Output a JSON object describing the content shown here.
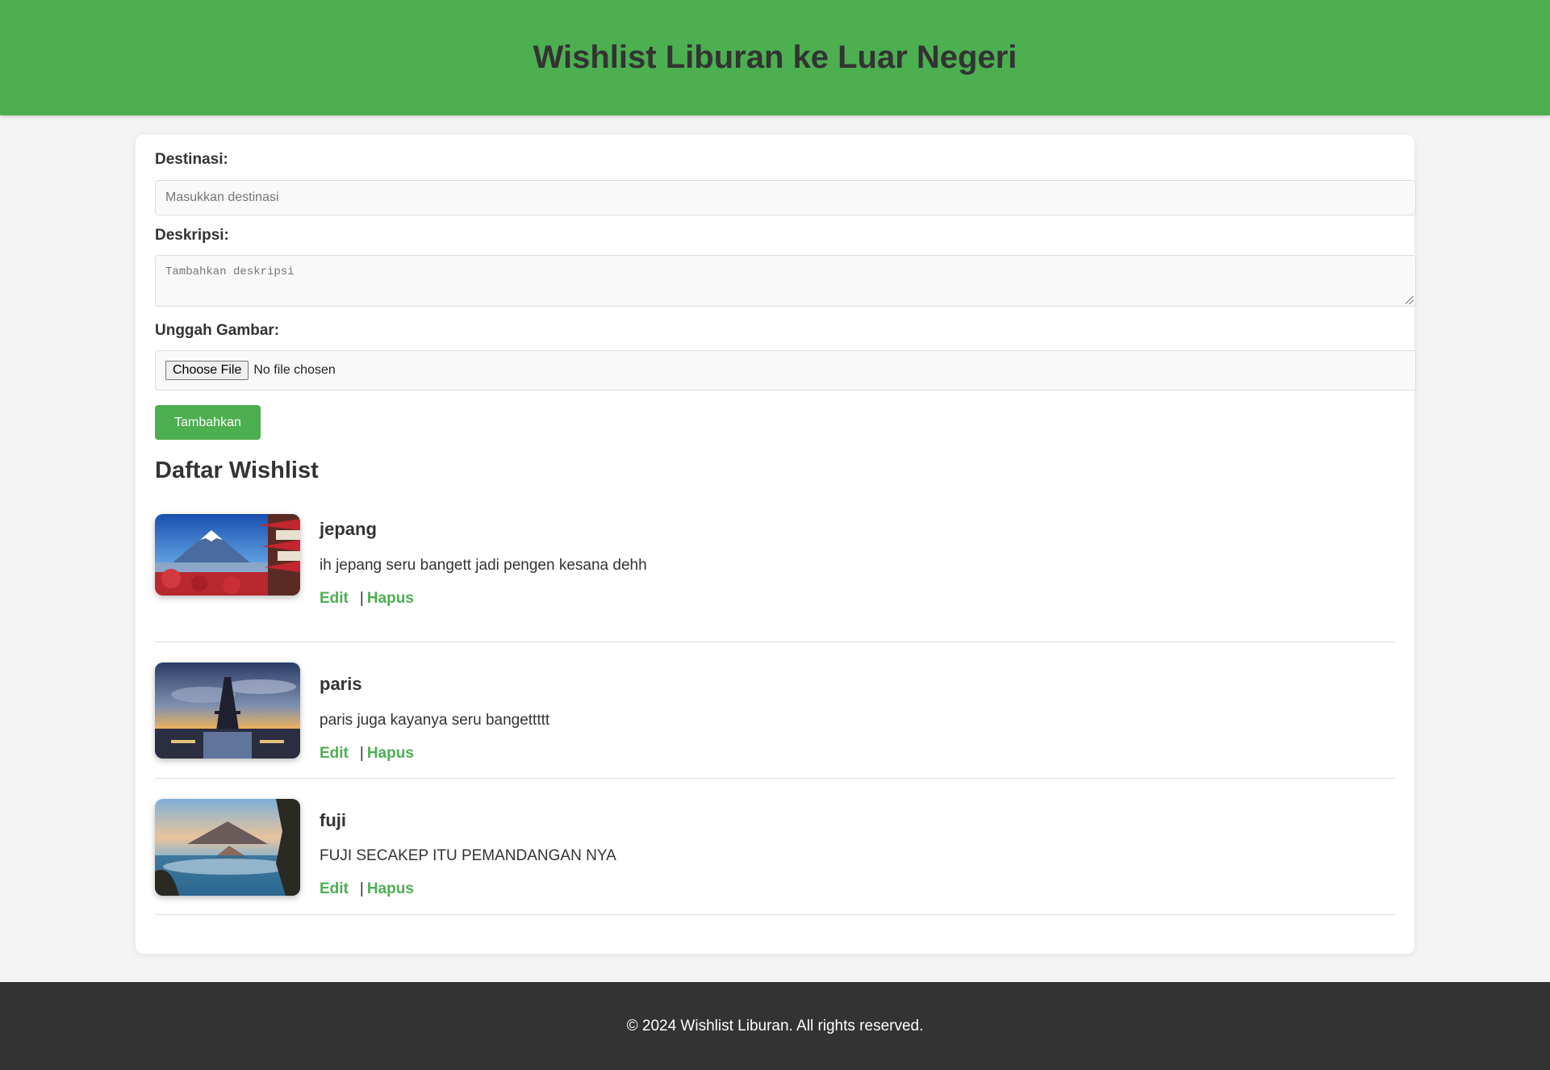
{
  "header": {
    "title": "Wishlist Liburan ke Luar Negeri"
  },
  "form": {
    "destination_label": "Destinasi:",
    "destination_placeholder": "Masukkan destinasi",
    "destination_value": "",
    "description_label": "Deskripsi:",
    "description_placeholder": "Tambahkan deskripsi",
    "description_value": "",
    "image_label": "Unggah Gambar:",
    "choose_file_label": "Choose File",
    "no_file_text": "No file chosen",
    "submit_label": "Tambahkan"
  },
  "wishlist": {
    "title": "Daftar Wishlist",
    "items": [
      {
        "name": "jepang",
        "description": "ih jepang seru bangett jadi pengen kesana dehh",
        "edit_label": "Edit",
        "separator": "|",
        "delete_label": "Hapus",
        "image_icon": "mount-fuji-pagoda-image"
      },
      {
        "name": "paris",
        "description": "paris juga kayanya seru bangettttt",
        "edit_label": "Edit",
        "separator": "|",
        "delete_label": "Hapus",
        "image_icon": "eiffel-tower-image"
      },
      {
        "name": "fuji",
        "description": "FUJI SECAKEP ITU PEMANDANGAN NYA",
        "edit_label": "Edit",
        "separator": "|",
        "delete_label": "Hapus",
        "image_icon": "volcano-landscape-image"
      }
    ]
  },
  "footer": {
    "text": "© 2024 Wishlist Liburan. All rights reserved."
  },
  "colors": {
    "accent": "#4caf50",
    "footer_bg": "#333333",
    "page_bg": "#f4f4f4"
  }
}
